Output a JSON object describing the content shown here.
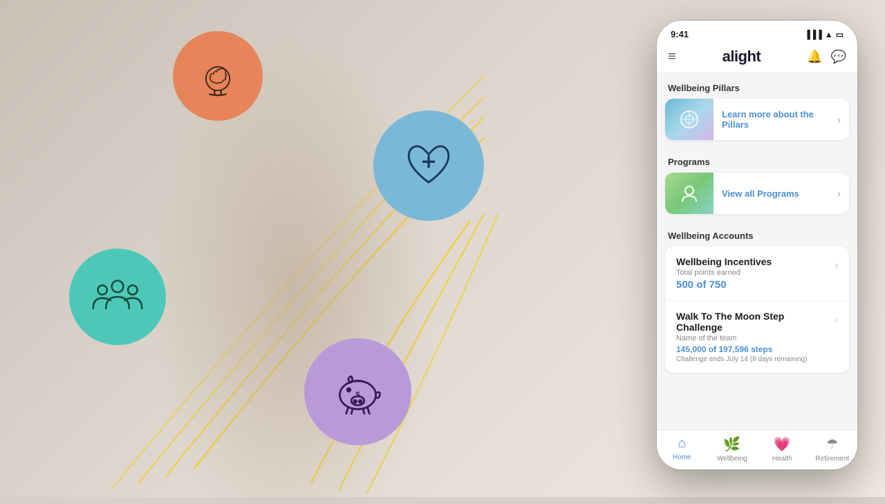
{
  "scene": {
    "background_color": "#cfc5bb"
  },
  "status_bar": {
    "time": "9:41",
    "signal": "●●●",
    "wifi": "wifi",
    "battery": "battery"
  },
  "header": {
    "menu_label": "≡",
    "logo": "alight",
    "bell_icon": "🔔",
    "chat_icon": "💬"
  },
  "sections": {
    "wellbeing_pillars": {
      "label": "Wellbeing Pillars",
      "card": {
        "link_text": "Learn more about the Pillars",
        "chevron": "›"
      }
    },
    "programs": {
      "label": "Programs",
      "card": {
        "link_text": "View all Programs",
        "chevron": "›"
      }
    },
    "wellbeing_accounts": {
      "label": "Wellbeing Accounts",
      "items": [
        {
          "title": "Wellbeing Incentives",
          "subtitle": "Total points earned",
          "value": "500 of 750",
          "detail": "",
          "chevron": "›"
        },
        {
          "title": "Walk To The Moon Step Challenge",
          "subtitle": "Name of the team",
          "value": "145,000 of 197,596 steps",
          "detail": "Challenge ends July 14 (8 days remaining)",
          "chevron": "›"
        }
      ]
    }
  },
  "bottom_nav": {
    "items": [
      {
        "icon": "🏠",
        "label": "Home",
        "active": true
      },
      {
        "icon": "🌿",
        "label": "Wellbeing",
        "active": false
      },
      {
        "icon": "💗",
        "label": "Health",
        "active": false
      },
      {
        "icon": "☂",
        "label": "Retirement",
        "active": false
      }
    ]
  },
  "bubbles": {
    "brain": {
      "emoji": "🧠"
    },
    "heart": {
      "emoji": "❤️"
    },
    "team": {
      "emoji": "👥"
    },
    "piggy": {
      "emoji": "🐷"
    }
  }
}
